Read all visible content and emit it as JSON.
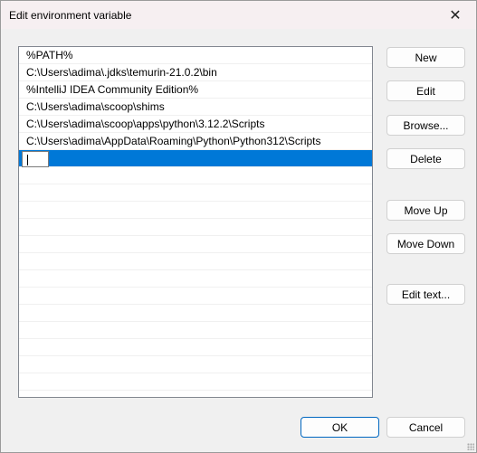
{
  "window": {
    "title": "Edit environment variable",
    "close_icon": "close-icon"
  },
  "list": {
    "items": [
      "%PATH%",
      "C:\\Users\\adima\\.jdks\\temurin-21.0.2\\bin",
      "%IntelliJ IDEA Community Edition%",
      "C:\\Users\\adima\\scoop\\shims",
      "C:\\Users\\adima\\scoop\\apps\\python\\3.12.2\\Scripts",
      "C:\\Users\\adima\\AppData\\Roaming\\Python\\Python312\\Scripts"
    ],
    "editing_value": ""
  },
  "buttons": {
    "new": "New",
    "edit": "Edit",
    "browse": "Browse...",
    "delete": "Delete",
    "move_up": "Move Up",
    "move_down": "Move Down",
    "edit_text": "Edit text...",
    "ok": "OK",
    "cancel": "Cancel"
  }
}
